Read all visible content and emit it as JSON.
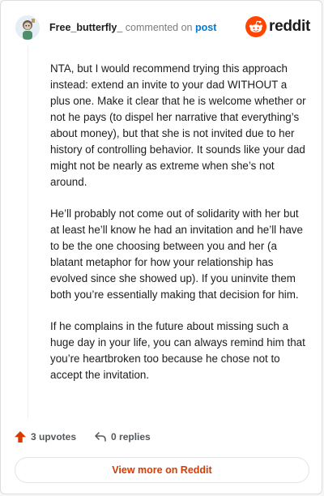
{
  "comment": {
    "username": "Free_butterfly_",
    "action_text": "commented on",
    "target_link": "post",
    "paragraphs": [
      "NTA, but I would recommend trying this approach instead: extend an invite to your dad WITHOUT a plus one. Make it clear that he is welcome whether or not he pays (to dispel her narrative that everything’s about money), but that she is not invited due to her history of controlling behavior. It sounds like your dad might not be nearly as extreme when she’s not around.",
      "He’ll probably not come out of solidarity with her but at least he’ll know he had an invitation and he’ll have to be the one choosing between you and her (a blatant metaphor for how your relationship has evolved since she showed up). If you uninvite them both you’re essentially making that decision for him.",
      "If he complains in the future about missing such a huge day in your life, you can always remind him that you’re heartbroken too because he chose not to accept the invitation."
    ],
    "upvotes_label": "3 upvotes",
    "replies_label": "0 replies"
  },
  "brand": {
    "wordmark": "reddit",
    "icon": "reddit-logo-icon",
    "color": "#ff4500"
  },
  "footer": {
    "view_more_label": "View more on Reddit"
  },
  "colors": {
    "accent_link": "#0079d3",
    "upvote": "#d93a00",
    "view_more_text": "#d93a00"
  }
}
